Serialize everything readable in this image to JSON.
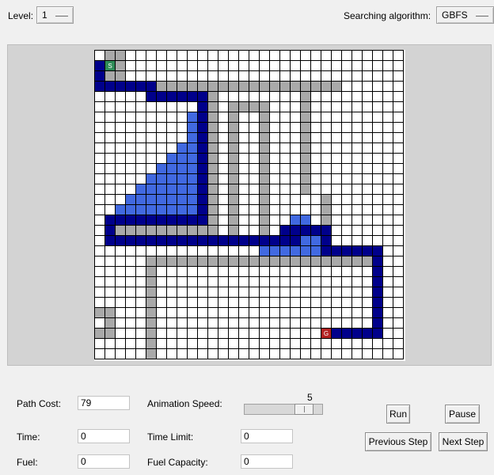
{
  "toolbar": {
    "level_label": "Level:",
    "level_value": "1",
    "algorithm_label": "Searching algorithm:",
    "algorithm_value": "GBFS"
  },
  "grid": {
    "cols": 30,
    "rows": 30,
    "colors": {
      "empty": "#ffffff",
      "wall": "#a9a9a9",
      "path": "#00008b",
      "visited": "#4169e1",
      "start": "#2e8b57",
      "goal": "#b22222",
      "line": "#000000"
    },
    "start": {
      "col": 1,
      "row": 1,
      "label": "S"
    },
    "goal": {
      "col": 22,
      "row": 27,
      "label": "G"
    }
  },
  "panel": {
    "path_cost_label": "Path Cost:",
    "path_cost_value": "79",
    "time_label": "Time:",
    "time_value": "0",
    "fuel_label": "Fuel:",
    "fuel_value": "0",
    "animation_speed_label": "Animation Speed:",
    "animation_speed_value": "5",
    "animation_speed_level": 0.85,
    "time_limit_label": "Time Limit:",
    "time_limit_value": "0",
    "fuel_capacity_label": "Fuel Capacity:",
    "fuel_capacity_value": "0"
  },
  "buttons": {
    "run": "Run",
    "pause": "Pause",
    "previous_step": "Previous Step",
    "next_step": "Next Step"
  }
}
